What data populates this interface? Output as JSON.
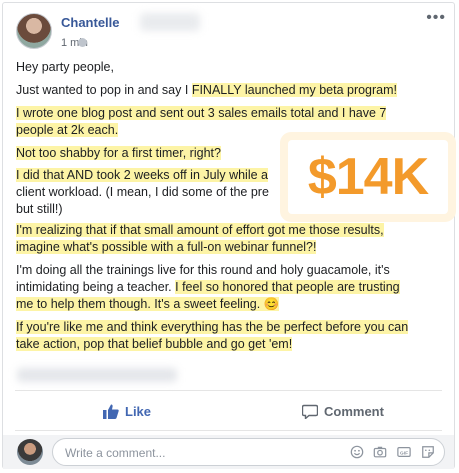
{
  "post": {
    "author": "Chantelle",
    "time": "1 min",
    "lines": [
      {
        "text": "Hey party people,",
        "hl": false
      },
      {
        "text": "Just wanted to pop in and say I ",
        "hl": false,
        "tail": "FINALLY launched my beta program!"
      },
      {
        "text": "I wrote one blog post and sent out 3 sales emails total and I have 7",
        "hl": true
      },
      {
        "text": "people at 2k each.",
        "hl": true
      },
      {
        "text": "Not too shabby for a first timer, right?",
        "hl": true
      },
      {
        "text": "I did that AND took 2 weeks off in July while a",
        "hl": true
      },
      {
        "text": "client workload. (I mean, I did some of the pre",
        "hl": false
      },
      {
        "text": "but still!)",
        "hl": false
      },
      {
        "text": "I'm realizing that if that small amount of effort got me those results,",
        "hl": true
      },
      {
        "text": "imagine what's possible with a full-on webinar funnel?!",
        "hl": true
      },
      {
        "text": "I'm doing all the trainings live for this round and holy guacamole, it's",
        "hl": false
      },
      {
        "text": "intimidating being a teacher. ",
        "hl": false,
        "tail": "I feel so honored that people are trusting"
      },
      {
        "text": "me to help them though. It's a sweet feeling. ",
        "hl": true,
        "emoji": "😊"
      },
      {
        "text": "If you're like me and think everything has the be perfect before you can",
        "hl": true
      },
      {
        "text": "take action, pop that belief bubble and go get 'em!",
        "hl": true
      }
    ]
  },
  "badge": {
    "text": "$14K",
    "color": "#f39a2b"
  },
  "actions": {
    "like_label": "Like",
    "comment_label": "Comment"
  },
  "composer": {
    "placeholder": "Write a comment..."
  },
  "colors": {
    "highlight": "#fdf4a6",
    "link": "#385898",
    "like": "#4267b2"
  }
}
